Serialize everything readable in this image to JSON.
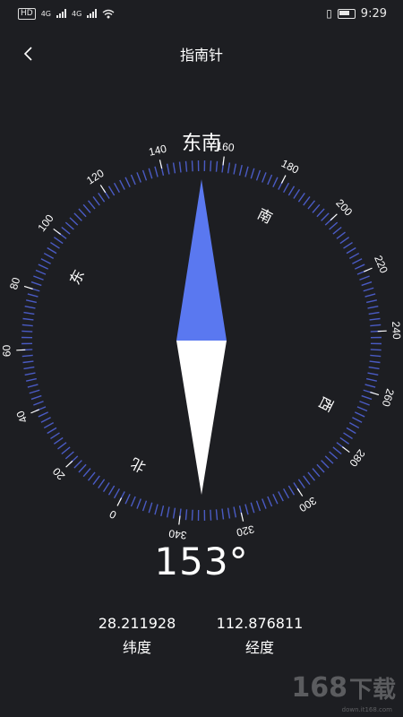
{
  "status_bar": {
    "hd_badge": "HD",
    "network_1": "4G",
    "network_2": "4G",
    "time": "9:29",
    "icons": [
      "signal-icon",
      "wifi-icon",
      "vibrate-icon",
      "battery-icon"
    ]
  },
  "header": {
    "title": "指南针",
    "back_icon": "chevron-left-icon"
  },
  "compass": {
    "direction": "东南",
    "heading_degrees": "153°",
    "heading_value": 153,
    "degree_labels": [
      "0",
      "20",
      "40",
      "60",
      "80",
      "100",
      "120",
      "140",
      "160",
      "180",
      "200",
      "220",
      "240",
      "260",
      "280",
      "300",
      "320",
      "340"
    ],
    "cardinals": {
      "north": "北",
      "east": "东",
      "south": "南",
      "west": "西"
    },
    "colors": {
      "ring": "#4a5bc4",
      "needle_north": "#5a78f0",
      "needle_south": "#ffffff",
      "background": "#1d1e22"
    }
  },
  "location": {
    "latitude": "28.211928",
    "latitude_label": "纬度",
    "longitude": "112.876811",
    "longitude_label": "经度"
  },
  "watermark": {
    "text": "168",
    "sub": "下载",
    "url": "down.it168.com"
  }
}
